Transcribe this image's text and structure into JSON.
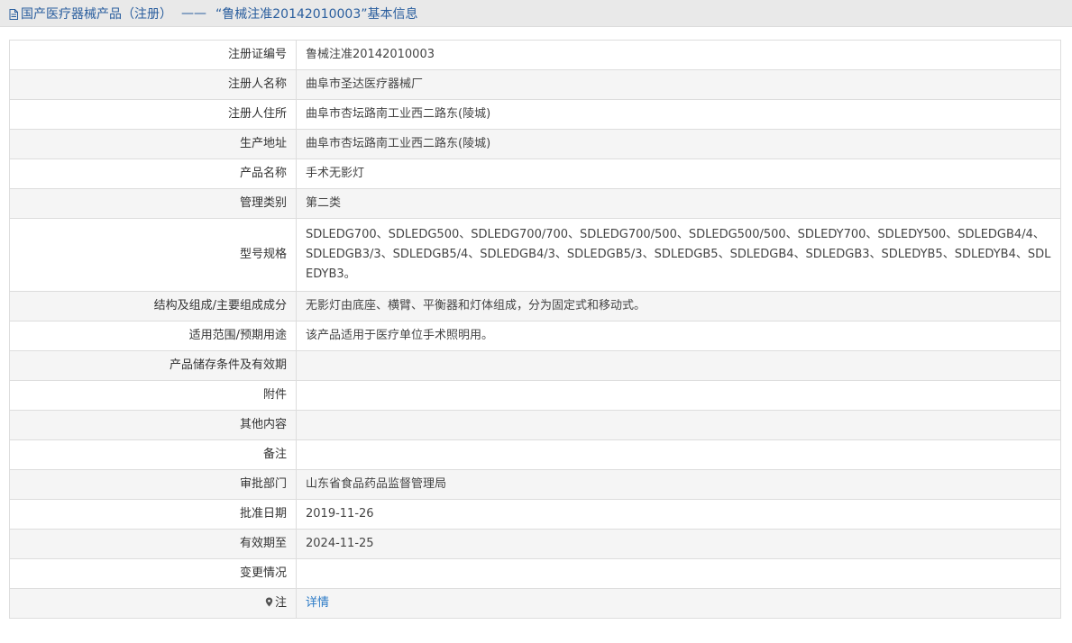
{
  "header": {
    "icon": "document-icon",
    "category": "国产医疗器械产品（注册）",
    "separator": "——",
    "record_title": "“鲁械注准20142010003”基本信息"
  },
  "rows": [
    {
      "label": "注册证编号",
      "value": "鲁械注准20142010003"
    },
    {
      "label": "注册人名称",
      "value": "曲阜市圣达医疗器械厂"
    },
    {
      "label": "注册人住所",
      "value": "曲阜市杏坛路南工业西二路东(陵城)"
    },
    {
      "label": "生产地址",
      "value": "曲阜市杏坛路南工业西二路东(陵城)"
    },
    {
      "label": "产品名称",
      "value": "手术无影灯"
    },
    {
      "label": "管理类别",
      "value": "第二类"
    },
    {
      "label": "型号规格",
      "value": "SDLEDG700、SDLEDG500、SDLEDG700/700、SDLEDG700/500、SDLEDG500/500、SDLEDY700、SDLEDY500、SDLEDGB4/4、SDLEDGB3/3、SDLEDGB5/4、SDLEDGB4/3、SDLEDGB5/3、SDLEDGB5、SDLEDGB4、SDLEDGB3、SDLEDYB5、SDLEDYB4、SDLEDYB3。"
    },
    {
      "label": "结构及组成/主要组成成分",
      "value": "无影灯由底座、横臂、平衡器和灯体组成，分为固定式和移动式。"
    },
    {
      "label": "适用范围/预期用途",
      "value": "该产品适用于医疗单位手术照明用。"
    },
    {
      "label": "产品储存条件及有效期",
      "value": ""
    },
    {
      "label": "附件",
      "value": ""
    },
    {
      "label": "其他内容",
      "value": ""
    },
    {
      "label": "备注",
      "value": ""
    },
    {
      "label": "审批部门",
      "value": "山东省食品药品监督管理局"
    },
    {
      "label": "批准日期",
      "value": "2019-11-26"
    },
    {
      "label": "有效期至",
      "value": "2024-11-25"
    },
    {
      "label": "变更情况",
      "value": ""
    }
  ],
  "note_row": {
    "icon": "pin-icon",
    "label": "注",
    "link_text": "详情"
  },
  "colors": {
    "title_text": "#2a5e9e",
    "link": "#2a7ac6",
    "stripe": "#f5f5f5",
    "border": "#dddddd"
  }
}
